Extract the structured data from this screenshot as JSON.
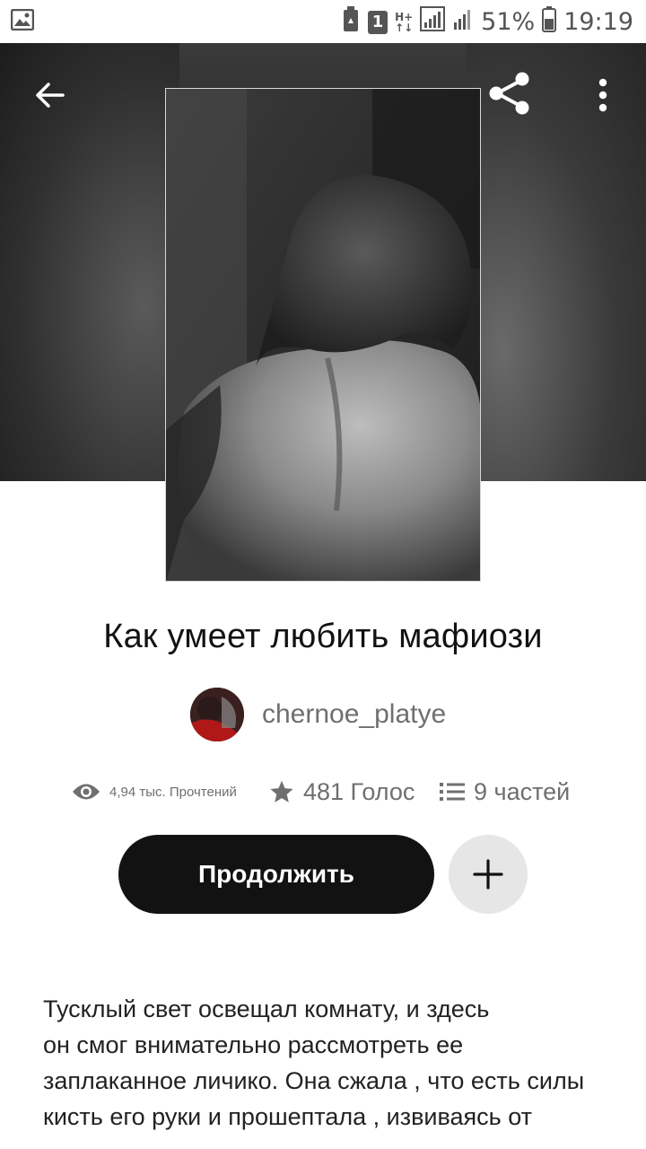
{
  "status_bar": {
    "battery_percent": "51%",
    "time": "19:19",
    "sim_slot": "1",
    "network_type_top": "H+",
    "network_type_bottom": "↑↓"
  },
  "header": {
    "back_icon": "arrow-left-icon",
    "share_icon": "share-icon",
    "more_icon": "more-vertical-icon"
  },
  "story": {
    "title": "Как умеет любить мафиози",
    "author": "chernoe_platye",
    "reads": "4,94 тыс. Прочтений",
    "votes": "481 Голос",
    "parts": "9 частей",
    "description": "Тусклый свет освещал комнату, и здесь\nон смог внимательно рассмотреть ее\nзаплаканное личико. Она сжала , что есть силы\nкисть его руки и прошептала , извиваясь от"
  },
  "actions": {
    "continue_label": "Продолжить",
    "add_icon": "plus-icon"
  },
  "colors": {
    "primary_button": "#121212",
    "secondary_button": "#e6e6e6",
    "muted_text": "#6f6f6f"
  }
}
